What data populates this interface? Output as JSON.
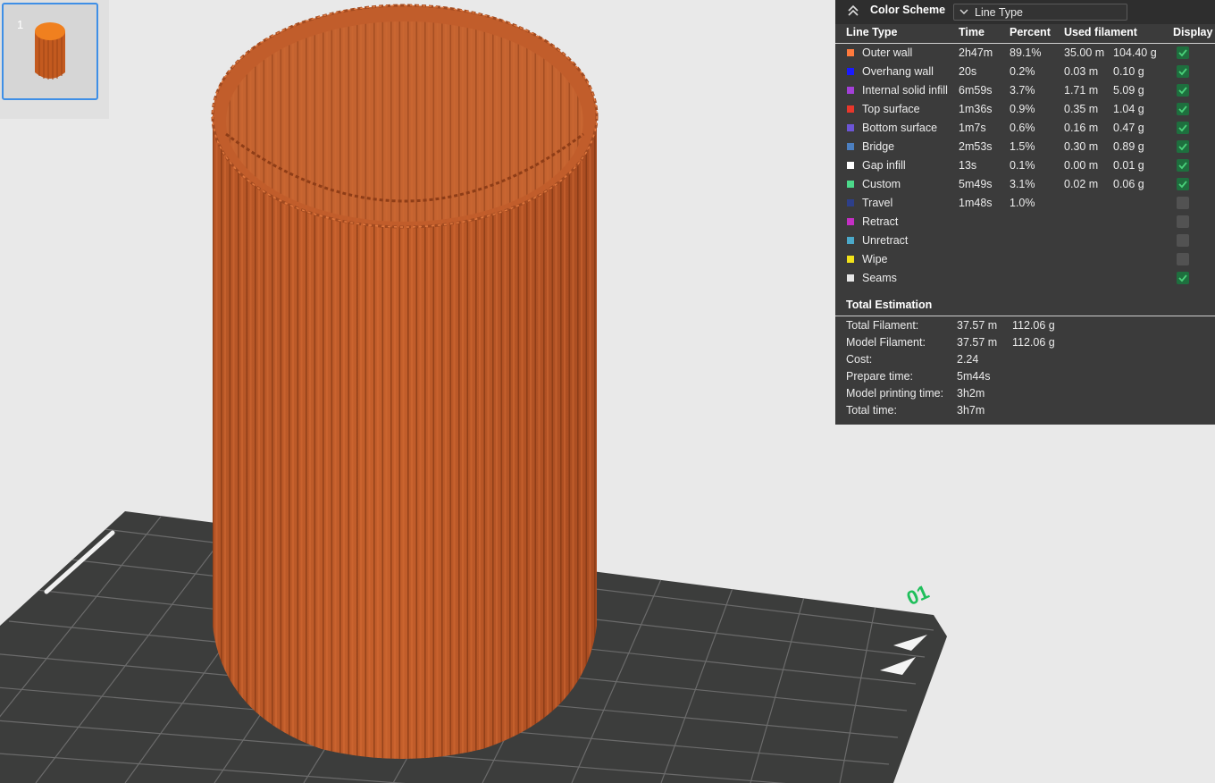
{
  "thumbnail": {
    "plate_number": "1"
  },
  "plate": {
    "label": "01"
  },
  "legend_panel": {
    "title": "Color Scheme",
    "scheme_value": "Line Type",
    "headers": {
      "line_type": "Line Type",
      "time": "Time",
      "percent": "Percent",
      "used": "Used filament",
      "display": "Display"
    },
    "rows": [
      {
        "color": "#ff7a3d",
        "name": "Outer wall",
        "time": "2h47m",
        "percent": "89.1%",
        "len": "35.00 m",
        "weight": "104.40 g",
        "display": true
      },
      {
        "color": "#1a1aff",
        "name": "Overhang wall",
        "time": "20s",
        "percent": "0.2%",
        "len": "0.03 m",
        "weight": "0.10 g",
        "display": true
      },
      {
        "color": "#a340d8",
        "name": "Internal solid infill",
        "time": "6m59s",
        "percent": "3.7%",
        "len": "1.71 m",
        "weight": "5.09 g",
        "display": true
      },
      {
        "color": "#e8372b",
        "name": "Top surface",
        "time": "1m36s",
        "percent": "0.9%",
        "len": "0.35 m",
        "weight": "1.04 g",
        "display": true
      },
      {
        "color": "#6c55d6",
        "name": "Bottom surface",
        "time": "1m7s",
        "percent": "0.6%",
        "len": "0.16 m",
        "weight": "0.47 g",
        "display": true
      },
      {
        "color": "#4c7fc0",
        "name": "Bridge",
        "time": "2m53s",
        "percent": "1.5%",
        "len": "0.30 m",
        "weight": "0.89 g",
        "display": true
      },
      {
        "color": "#ffffff",
        "name": "Gap infill",
        "time": "13s",
        "percent": "0.1%",
        "len": "0.00 m",
        "weight": "0.01 g",
        "display": true
      },
      {
        "color": "#4cd98a",
        "name": "Custom",
        "time": "5m49s",
        "percent": "3.1%",
        "len": "0.02 m",
        "weight": "0.06 g",
        "display": true
      },
      {
        "color": "#2d3f8a",
        "name": "Travel",
        "time": "1m48s",
        "percent": "1.0%",
        "len": "",
        "weight": "",
        "display": false
      },
      {
        "color": "#c42fc4",
        "name": "Retract",
        "time": "",
        "percent": "",
        "len": "",
        "weight": "",
        "display": false
      },
      {
        "color": "#4ba9c9",
        "name": "Unretract",
        "time": "",
        "percent": "",
        "len": "",
        "weight": "",
        "display": false
      },
      {
        "color": "#f2e21a",
        "name": "Wipe",
        "time": "",
        "percent": "",
        "len": "",
        "weight": "",
        "display": false
      },
      {
        "color": "#e6e6e6",
        "name": "Seams",
        "time": "",
        "percent": "",
        "len": "",
        "weight": "",
        "display": true
      }
    ],
    "total": {
      "title": "Total Estimation",
      "rows": [
        {
          "label": "Total Filament:",
          "value": "37.57 m",
          "value2": "112.06 g"
        },
        {
          "label": "Model Filament:",
          "value": "37.57 m",
          "value2": "112.06 g"
        },
        {
          "label": "Cost:",
          "value": "2.24",
          "value2": ""
        },
        {
          "label": "Prepare time:",
          "value": "5m44s",
          "value2": ""
        },
        {
          "label": "Model printing time:",
          "value": "3h2m",
          "value2": ""
        },
        {
          "label": "Total time:",
          "value": "3h7m",
          "value2": ""
        }
      ]
    }
  }
}
